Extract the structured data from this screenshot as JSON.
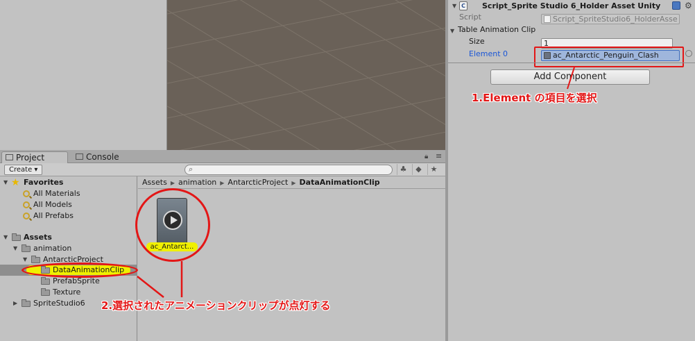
{
  "inspector": {
    "header_title": "Script_Sprite Studio 6_Holder Asset Unity",
    "script_label": "Script",
    "script_value": "Script_SpriteStudio6_HolderAsse",
    "table_label": "Table Animation Clip",
    "size_label": "Size",
    "size_value": "1",
    "element_label": "Element 0",
    "element_value": "ac_Antarctic_Penguin_Clash",
    "add_component_label": "Add Component"
  },
  "annotations": {
    "step1": "1.Element の項目を選択",
    "step2": "2.選択されたアニメーションクリップが点灯する",
    "color": "#e31616"
  },
  "project": {
    "tabs": [
      {
        "label": "Project"
      },
      {
        "label": "Console"
      }
    ],
    "create_label": "Create ▾",
    "tree": {
      "favorites_label": "Favorites",
      "favorites": [
        "All Materials",
        "All Models",
        "All Prefabs"
      ],
      "assets_label": "Assets",
      "animation_label": "animation",
      "antarctic_label": "AntarcticProject",
      "selected_folder": "DataAnimationClip",
      "prefab_label": "PrefabSprite",
      "texture_label": "Texture",
      "spritestudio_label": "SpriteStudio6"
    },
    "breadcrumb": [
      "Assets",
      "animation",
      "AntarcticProject",
      "DataAnimationClip"
    ],
    "asset_label": "ac_Antarct..."
  },
  "colors": {
    "scene_bg": "#6a6158",
    "highlight_yellow": "#f0f000",
    "selection_blue": "#9fb6dc"
  }
}
